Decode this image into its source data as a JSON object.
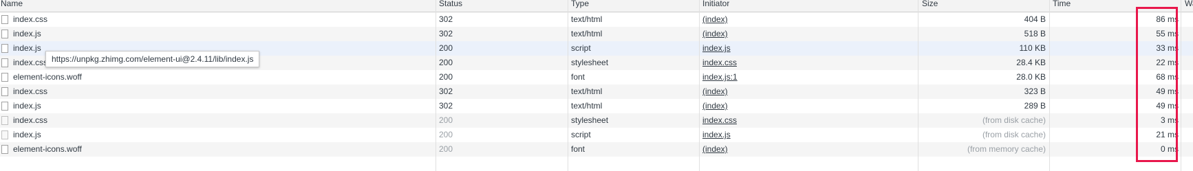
{
  "columns": {
    "name": "Name",
    "status": "Status",
    "type": "Type",
    "initiator": "Initiator",
    "size": "Size",
    "time": "Time",
    "waterfall": "Wa"
  },
  "rows": [
    {
      "name": "index.css",
      "status": "302",
      "type": "text/html",
      "initiator": "(index)",
      "size": "404 B",
      "time": "86 ms"
    },
    {
      "name": "index.js",
      "status": "302",
      "type": "text/html",
      "initiator": "(index)",
      "size": "518 B",
      "time": "55 ms"
    },
    {
      "name": "index.js",
      "status": "200",
      "type": "script",
      "initiator": "index.js",
      "size": "110 KB",
      "time": "33 ms"
    },
    {
      "name": "index.css",
      "status": "200",
      "type": "stylesheet",
      "initiator": "index.css",
      "size": "28.4 KB",
      "time": "22 ms"
    },
    {
      "name": "element-icons.woff",
      "status": "200",
      "type": "font",
      "initiator": "index.js:1",
      "size": "28.0 KB",
      "time": "68 ms"
    },
    {
      "name": "index.css",
      "status": "302",
      "type": "text/html",
      "initiator": "(index)",
      "size": "323 B",
      "time": "49 ms"
    },
    {
      "name": "index.js",
      "status": "302",
      "type": "text/html",
      "initiator": "(index)",
      "size": "289 B",
      "time": "49 ms"
    },
    {
      "name": "index.css",
      "status": "200",
      "type": "stylesheet",
      "initiator": "index.css",
      "size": "(from disk cache)",
      "time": "3 ms"
    },
    {
      "name": "index.js",
      "status": "200",
      "type": "script",
      "initiator": "index.js",
      "size": "(from disk cache)",
      "time": "21 ms"
    },
    {
      "name": "element-icons.woff",
      "status": "200",
      "type": "font",
      "initiator": "(index)",
      "size": "(from memory cache)",
      "time": "0 ms"
    }
  ],
  "tooltip": "https://unpkg.zhimg.com/element-ui@2.4.11/lib/index.js",
  "colors": {
    "highlight_box": "#e8174b",
    "row_hover": "#ebf1fb",
    "header_bg": "#f3f3f3"
  }
}
